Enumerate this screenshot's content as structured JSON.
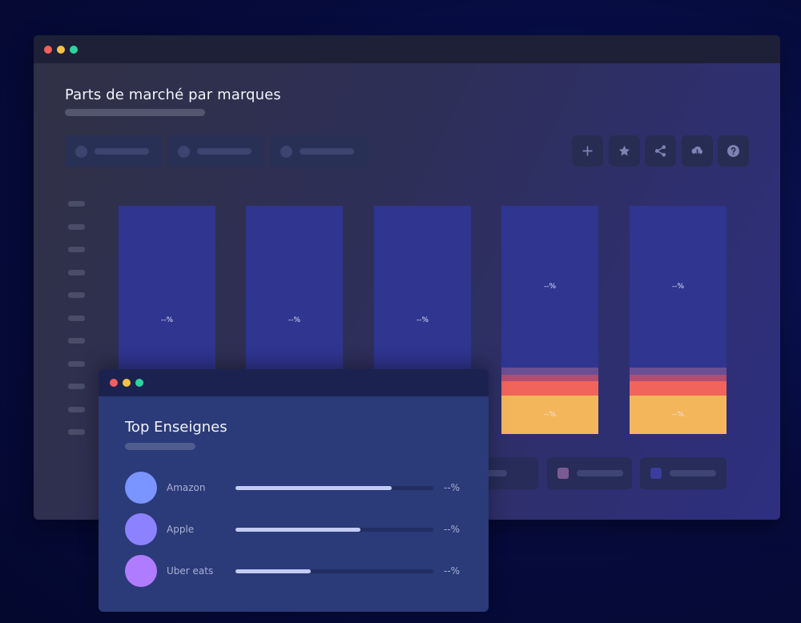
{
  "main_window": {
    "title": "Parts de marché par marques",
    "toolbar": {
      "add_icon": "plus-icon",
      "favorite_icon": "star-icon",
      "share_icon": "share-icon",
      "download_icon": "cloud-download-icon",
      "help_icon": "help-icon"
    }
  },
  "chart_data": {
    "type": "bar",
    "stacked": true,
    "columns": [
      {
        "segments": [
          {
            "label": "--%",
            "share": 1.0,
            "color": "#303590"
          }
        ]
      },
      {
        "segments": [
          {
            "label": "--%",
            "share": 1.0,
            "color": "#303590"
          }
        ]
      },
      {
        "segments": [
          {
            "label": "--%",
            "share": 1.0,
            "color": "#303590"
          }
        ]
      },
      {
        "segments": [
          {
            "label": "--%",
            "share": 0.71,
            "color": "#303590"
          },
          {
            "label": "",
            "share": 0.03,
            "color": "#6b4f94"
          },
          {
            "label": "",
            "share": 0.03,
            "color": "#b04d73"
          },
          {
            "label": "",
            "share": 0.06,
            "color": "#f0645b"
          },
          {
            "label": "--%",
            "share": 0.17,
            "color": "#f3b65a"
          }
        ]
      },
      {
        "segments": [
          {
            "label": "--%",
            "share": 0.71,
            "color": "#303590"
          },
          {
            "label": "",
            "share": 0.03,
            "color": "#6b4f94"
          },
          {
            "label": "",
            "share": 0.03,
            "color": "#b04d73"
          },
          {
            "label": "",
            "share": 0.06,
            "color": "#f0645b"
          },
          {
            "label": "--%",
            "share": 0.17,
            "color": "#f3b65a"
          }
        ]
      }
    ],
    "legend_swatches": [
      "#7a5a92",
      "#3a3c9e"
    ]
  },
  "popup": {
    "title": "Top Enseignes",
    "items": [
      {
        "name": "Amazon",
        "value": "--%",
        "fill": 0.79,
        "color": "#7a95ff"
      },
      {
        "name": "Apple",
        "value": "--%",
        "fill": 0.63,
        "color": "#8c82ff"
      },
      {
        "name": "Uber eats",
        "value": "--%",
        "fill": 0.38,
        "color": "#b07cff"
      }
    ]
  }
}
